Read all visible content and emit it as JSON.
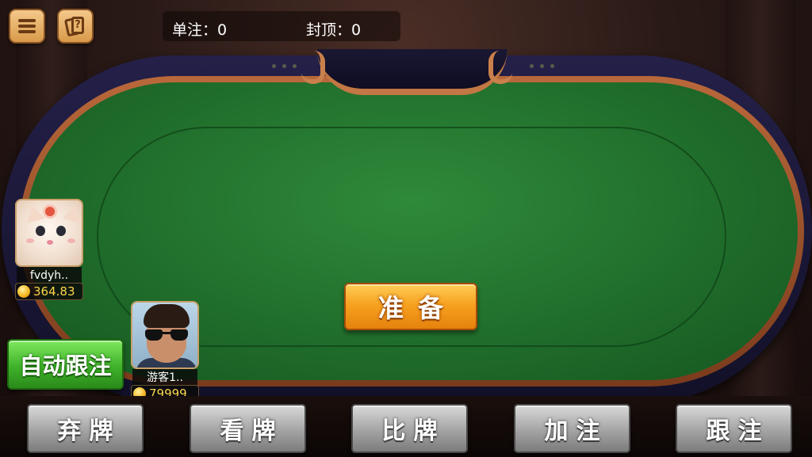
{
  "top_bar": {
    "menu_icon": "hamburger-menu-icon",
    "rules_icon": "card-help-icon",
    "rules_glyph": "?",
    "single_bet": "单注：0",
    "bet_cap": "封顶：0"
  },
  "table": {
    "ready_label": "准备"
  },
  "players": [
    {
      "name": "fvdyh..",
      "coins": "364.83",
      "avatar": "cat-photo"
    },
    {
      "name": "游客1..",
      "coins": "79999",
      "avatar": "man-sunglasses-photo"
    }
  ],
  "auto_follow_label": "自动跟注",
  "actions": [
    {
      "label": "弃牌"
    },
    {
      "label": "看牌"
    },
    {
      "label": "比牌"
    },
    {
      "label": "加注"
    },
    {
      "label": "跟注"
    }
  ],
  "colors": {
    "felt": "#1f6b2a",
    "rail": "#1a1733",
    "ready_button": "#f7a221",
    "auto_button": "#3fb22a",
    "action_button": "#a8a8a8",
    "coin_text": "#ffd54a"
  }
}
